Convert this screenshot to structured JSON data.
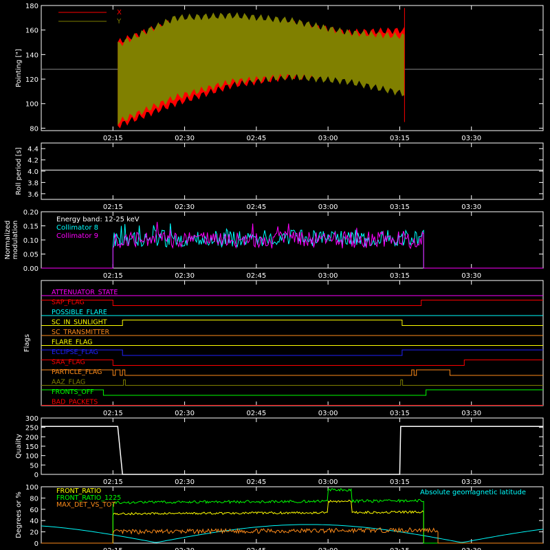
{
  "time_ticks": [
    "02:15",
    "02:30",
    "02:45",
    "03:00",
    "03:15",
    "03:30"
  ],
  "colors": {
    "bg": "#000000",
    "axis": "#ffffff",
    "x_series": "#ff0000",
    "y_series": "#808000",
    "cyan": "#00ffff",
    "magenta": "#ff00ff",
    "green": "#00ff00",
    "yellow": "#ffff00",
    "orange": "#ff8c1a",
    "blue": "#2020ff"
  },
  "chart_data": [
    {
      "type": "area",
      "id": "pointing",
      "ylabel": "Pointing [\"]",
      "ylim": [
        78,
        180
      ],
      "yticks": [
        80,
        100,
        120,
        140,
        160,
        180
      ],
      "legend": [
        "X",
        "Y"
      ],
      "series": [
        {
          "name": "X",
          "color": "#ff0000",
          "envelope_min_max": [
            [
              82,
              150
            ],
            [
              100,
              168
            ],
            [
              115,
              168
            ],
            [
              122,
              166
            ],
            [
              122,
              158
            ],
            [
              110,
              160
            ]
          ]
        },
        {
          "name": "Y",
          "color": "#808000",
          "envelope_min_max": [
            [
              85,
              148
            ],
            [
              105,
              170
            ],
            [
              118,
              172
            ],
            [
              122,
              168
            ],
            [
              118,
              158
            ],
            [
              108,
              155
            ]
          ]
        }
      ],
      "reference_level": 128,
      "data_window": [
        "02:16",
        "03:16"
      ]
    },
    {
      "type": "line",
      "id": "roll",
      "ylabel": "Roll period [s]",
      "ylim": [
        3.5,
        4.5
      ],
      "yticks": [
        "3.6",
        "3.8",
        "4.0",
        "4.2",
        "4.4"
      ],
      "series": [
        {
          "name": "",
          "value": 4.02
        }
      ]
    },
    {
      "type": "line",
      "id": "modulation",
      "ylabel": [
        "Normalized",
        "modulation"
      ],
      "ylim": [
        0,
        0.2
      ],
      "yticks": [
        "0.00",
        "0.05",
        "0.10",
        "0.15",
        "0.20"
      ],
      "annotations": [
        "Energy band: 12-25 keV"
      ],
      "legend": [
        "Collimator 8",
        "Collimator 9"
      ],
      "series": [
        {
          "name": "Collimator 8",
          "color": "#00ffff",
          "mean": 0.105
        },
        {
          "name": "Collimator 9",
          "color": "#ff00ff",
          "mean": 0.1
        }
      ],
      "data_window": [
        "02:15",
        "03:20"
      ]
    },
    {
      "type": "line",
      "id": "flags",
      "ylabel": "Flags",
      "series": [
        {
          "name": "ATTENUATOR_STATE",
          "color": "#ff00ff"
        },
        {
          "name": "SAP_FLAG",
          "color": "#ff0000"
        },
        {
          "name": "POSSIBLE_FLARE",
          "color": "#00ffff"
        },
        {
          "name": "SC_IN_SUNLIGHT",
          "color": "#ffff00"
        },
        {
          "name": "SC_TRANSMITTER",
          "color": "#ff8c1a"
        },
        {
          "name": "FLARE_FLAG",
          "color": "#ffff00"
        },
        {
          "name": "ECLIPSE_FLAG",
          "color": "#2020ff"
        },
        {
          "name": "SAA_FLAG",
          "color": "#ff0000"
        },
        {
          "name": "PARTICLE_FLAG",
          "color": "#ff8c1a"
        },
        {
          "name": "AAZ_FLAG",
          "color": "#808000"
        },
        {
          "name": "FRONTS_OFF",
          "color": "#00ff00"
        },
        {
          "name": "BAD_PACKETS",
          "color": "#ff0000"
        }
      ]
    },
    {
      "type": "line",
      "id": "quality",
      "ylabel": "Quality",
      "ylim": [
        0,
        300
      ],
      "yticks": [
        "0",
        "50",
        "100",
        "150",
        "200",
        "250",
        "300"
      ],
      "series": [
        {
          "name": "",
          "high": 255,
          "low": 0
        }
      ]
    },
    {
      "type": "line",
      "id": "ratios",
      "ylabel": "Degrees or %",
      "ylim": [
        0,
        100
      ],
      "yticks": [
        "0",
        "20",
        "40",
        "60",
        "80",
        "100"
      ],
      "legend": [
        "FRONT_RATIO",
        "FRONT_RATIO_1225",
        "MAX_DET_VS_TOT"
      ],
      "annotations": [
        "Absolute geomagnetic latitude"
      ],
      "series": [
        {
          "name": "FRONT_RATIO",
          "color": "#ffff00",
          "approx": 55
        },
        {
          "name": "FRONT_RATIO_1225",
          "color": "#00ff00",
          "approx": 75
        },
        {
          "name": "MAX_DET_VS_TOT",
          "color": "#ff8c1a",
          "approx": 20
        },
        {
          "name": "Absolute geomagnetic latitude",
          "color": "#00ffff",
          "range": [
            0,
            35
          ]
        }
      ]
    }
  ]
}
